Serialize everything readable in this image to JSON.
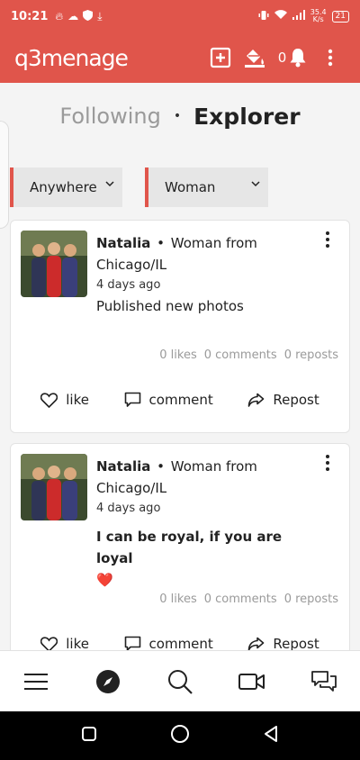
{
  "status_bar": {
    "time": "10:21",
    "left_icons": [
      "flame-icon",
      "cloud-icon",
      "shield-icon",
      "download-icon"
    ],
    "network_speed": "35.4",
    "network_unit": "K/s",
    "battery": "21"
  },
  "app_bar": {
    "logo": "q3menage",
    "notification_count": "0",
    "icons": [
      "add-square-icon",
      "paint-bucket-icon",
      "bell-icon",
      "more-vertical-icon"
    ]
  },
  "feed_tabs": {
    "following": "Following",
    "separator": "•",
    "explorer": "Explorer"
  },
  "filters": {
    "location": "Anywhere",
    "gender": "Woman"
  },
  "posts": [
    {
      "author": "Natalia",
      "separator": "•",
      "meta": "Woman from Chicago/IL",
      "time_ago": "4 days ago",
      "body": "Published new photos",
      "likes": "0 likes",
      "comments": "0 comments",
      "reposts": "0 reposts"
    },
    {
      "author": "Natalia",
      "separator": "•",
      "meta": "Woman from Chicago/IL",
      "time_ago": "4 days ago",
      "body": "I can be royal, if you are loyal",
      "emoji": "❤️",
      "likes": "0 likes",
      "comments": "0 comments",
      "reposts": "0 reposts"
    }
  ],
  "post_actions": {
    "like": "like",
    "comment": "comment",
    "repost": "Repost"
  },
  "bottom_nav": [
    "menu-icon",
    "compass-icon",
    "search-icon",
    "video-camera-icon",
    "chat-icon"
  ],
  "colors": {
    "brand": "#e0554b",
    "accent_heart": "#e53935"
  }
}
